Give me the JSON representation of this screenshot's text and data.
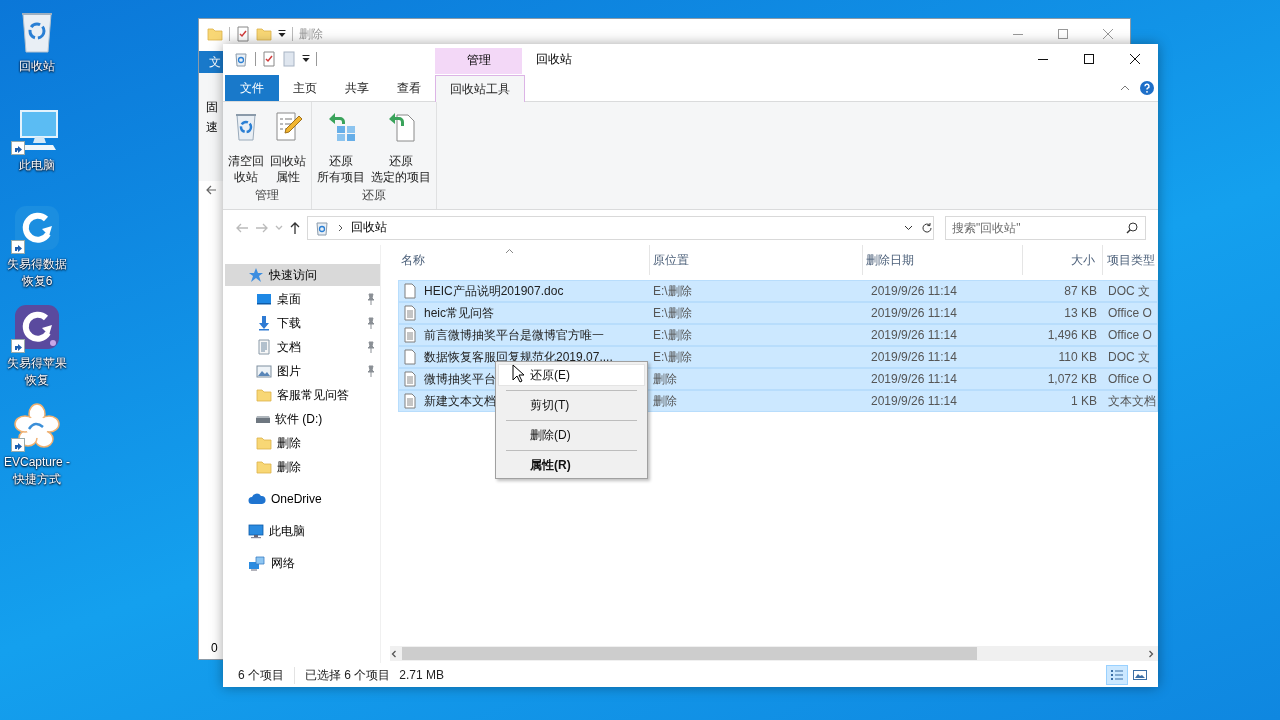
{
  "desktop_icons": [
    {
      "kind": "recycle-bin",
      "label": "回收站",
      "shortcut": false
    },
    {
      "kind": "computer",
      "label": "此电脑",
      "shortcut": true
    },
    {
      "kind": "recovery-app",
      "label": "失易得数据恢复6",
      "shortcut": true
    },
    {
      "kind": "apple-recovery-app",
      "label": "失易得苹果恢复",
      "shortcut": true
    },
    {
      "kind": "capture-app",
      "label": "EVCapture - 快捷方式",
      "shortcut": true
    }
  ],
  "back_window": {
    "title": "删除",
    "ribbon_tab": "文",
    "side_texts": [
      "固",
      "速"
    ],
    "bottom_text": "0"
  },
  "window": {
    "title": "回收站",
    "context_tab": "管理",
    "ribbon_tabs": [
      {
        "label": "文件",
        "kind": "file",
        "selected": false
      },
      {
        "label": "主页",
        "kind": "tab",
        "selected": false
      },
      {
        "label": "共享",
        "kind": "tab",
        "selected": false
      },
      {
        "label": "查看",
        "kind": "tab",
        "selected": false
      },
      {
        "label": "回收站工具",
        "kind": "tab",
        "selected": true
      }
    ],
    "ribbon_groups": [
      {
        "label": "管理",
        "buttons": [
          {
            "kind": "empty-bin",
            "lines": [
              "清空回",
              "收站"
            ]
          },
          {
            "kind": "properties",
            "lines": [
              "回收站",
              "属性"
            ]
          }
        ]
      },
      {
        "label": "还原",
        "buttons": [
          {
            "kind": "restore-all",
            "lines": [
              "还原",
              "所有项目"
            ]
          },
          {
            "kind": "restore-selected",
            "lines": [
              "还原",
              "选定的项目"
            ]
          }
        ]
      }
    ],
    "address": {
      "path": "回收站"
    },
    "search": {
      "placeholder": "搜索\"回收站\""
    },
    "nav": [
      {
        "label": "快速访问",
        "kind": "star",
        "selected": true,
        "children": [
          {
            "label": "桌面",
            "kind": "desktop",
            "selected": false,
            "pinned": true
          },
          {
            "label": "下载",
            "kind": "download",
            "selected": false,
            "pinned": true
          },
          {
            "label": "文档",
            "kind": "documents",
            "selected": false,
            "pinned": true
          },
          {
            "label": "图片",
            "kind": "pictures",
            "selected": false,
            "pinned": true
          },
          {
            "label": "客服常见问答",
            "kind": "folder",
            "selected": false,
            "pinned": false
          },
          {
            "label": "软件 (D:)",
            "kind": "drive",
            "selected": false,
            "pinned": false
          },
          {
            "label": "删除",
            "kind": "folder",
            "selected": false,
            "pinned": false
          },
          {
            "label": "删除",
            "kind": "folder",
            "selected": false,
            "pinned": false
          }
        ]
      },
      {
        "label": "OneDrive",
        "kind": "cloud",
        "selected": false
      },
      {
        "label": "此电脑",
        "kind": "pc",
        "selected": false
      },
      {
        "label": "网络",
        "kind": "network",
        "selected": false
      }
    ],
    "file_list": {
      "columns": [
        {
          "label": "名称",
          "kind": "name"
        },
        {
          "label": "原位置",
          "kind": "location"
        },
        {
          "label": "删除日期",
          "kind": "date"
        },
        {
          "label": "大小",
          "kind": "size"
        },
        {
          "label": "项目类型",
          "kind": "type"
        }
      ],
      "rows": [
        {
          "kind": "blank-doc",
          "name": "HEIC产品说明201907.doc",
          "location": "E:\\删除",
          "date": "2019/9/26 11:14",
          "size": "87 KB",
          "type": "DOC 文",
          "selected": true
        },
        {
          "kind": "text-doc",
          "name": "heic常见问答",
          "location": "E:\\删除",
          "date": "2019/9/26 11:14",
          "size": "13 KB",
          "type": "Office O",
          "selected": true
        },
        {
          "kind": "text-doc",
          "name": "前言微博抽奖平台是微博官方唯一",
          "location": "E:\\删除",
          "date": "2019/9/26 11:14",
          "size": "1,496 KB",
          "type": "Office O",
          "selected": true
        },
        {
          "kind": "blank-doc",
          "name": "数据恢复客服回复规范化2019.07....",
          "location": "E:\\删除",
          "date": "2019/9/26 11:14",
          "size": "110 KB",
          "type": "DOC 文",
          "selected": true
        },
        {
          "kind": "text-doc",
          "name": "微博抽奖平台",
          "location": "删除",
          "date": "2019/9/26 11:14",
          "size": "1,072 KB",
          "type": "Office O",
          "selected": true
        },
        {
          "kind": "text-doc",
          "name": "新建文本文档",
          "location": "删除",
          "date": "2019/9/26 11:14",
          "size": "1 KB",
          "type": "文本文档",
          "selected": true
        }
      ]
    },
    "status_bar": {
      "count": "6 个项目",
      "selection": "已选择 6 个项目",
      "size": "2.71 MB",
      "views": [
        {
          "kind": "details",
          "selected": true
        },
        {
          "kind": "large-icons",
          "selected": false
        }
      ]
    }
  },
  "context_menu": [
    {
      "label": "还原(E)",
      "default": false,
      "highlighted": true
    },
    {
      "label": "剪切(T)",
      "default": false,
      "highlighted": false
    },
    {
      "label": "删除(D)",
      "default": false,
      "highlighted": false
    },
    {
      "label": "属性(R)",
      "default": true,
      "highlighted": false
    }
  ]
}
